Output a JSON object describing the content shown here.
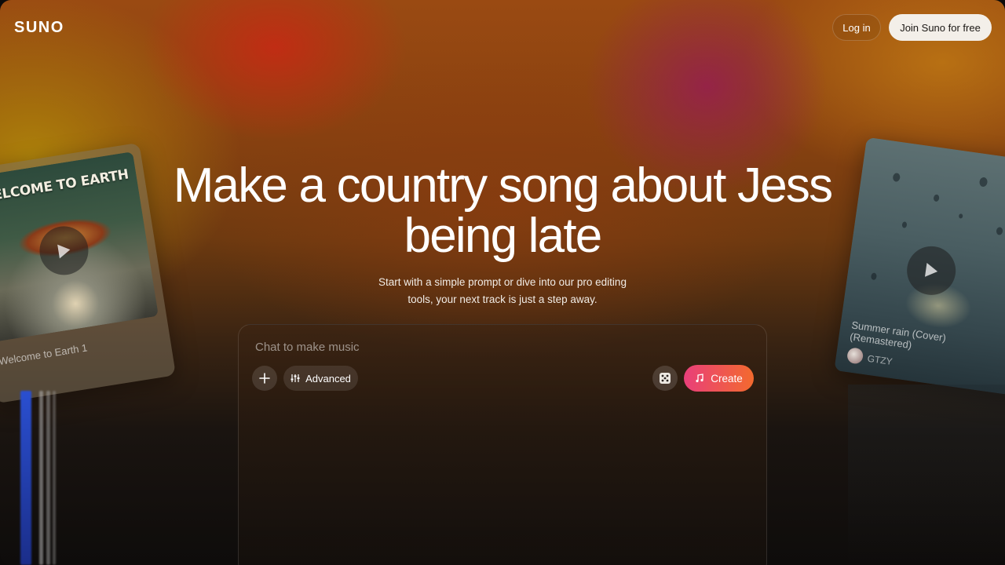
{
  "nav": {
    "logo": "SUNO",
    "login_label": "Log in",
    "join_label": "Join Suno for free"
  },
  "hero": {
    "headline_line1": "Make a country song about Jess",
    "headline_line2": "being late",
    "subtitle_line1": "Start with a simple prompt or dive into our pro editing",
    "subtitle_line2": "tools, your next track is just a step away."
  },
  "chat": {
    "placeholder": "Chat to make music",
    "add_icon": "plus-icon",
    "advanced_label": "Advanced",
    "advanced_icon": "sliders-icon",
    "random_icon": "dice-icon",
    "create_label": "Create",
    "create_icon": "music-note-icon",
    "create_gradient": [
      "#e93f7a",
      "#f36a2e"
    ]
  },
  "cards": {
    "left": {
      "art_text": "WELCOME TO EARTH",
      "title": "Welcome to Earth 1",
      "play_icon": "play-icon"
    },
    "right": {
      "title": "Summer rain (Cover) (Remastered)",
      "artist": "GTZY",
      "play_icon": "play-icon"
    }
  }
}
